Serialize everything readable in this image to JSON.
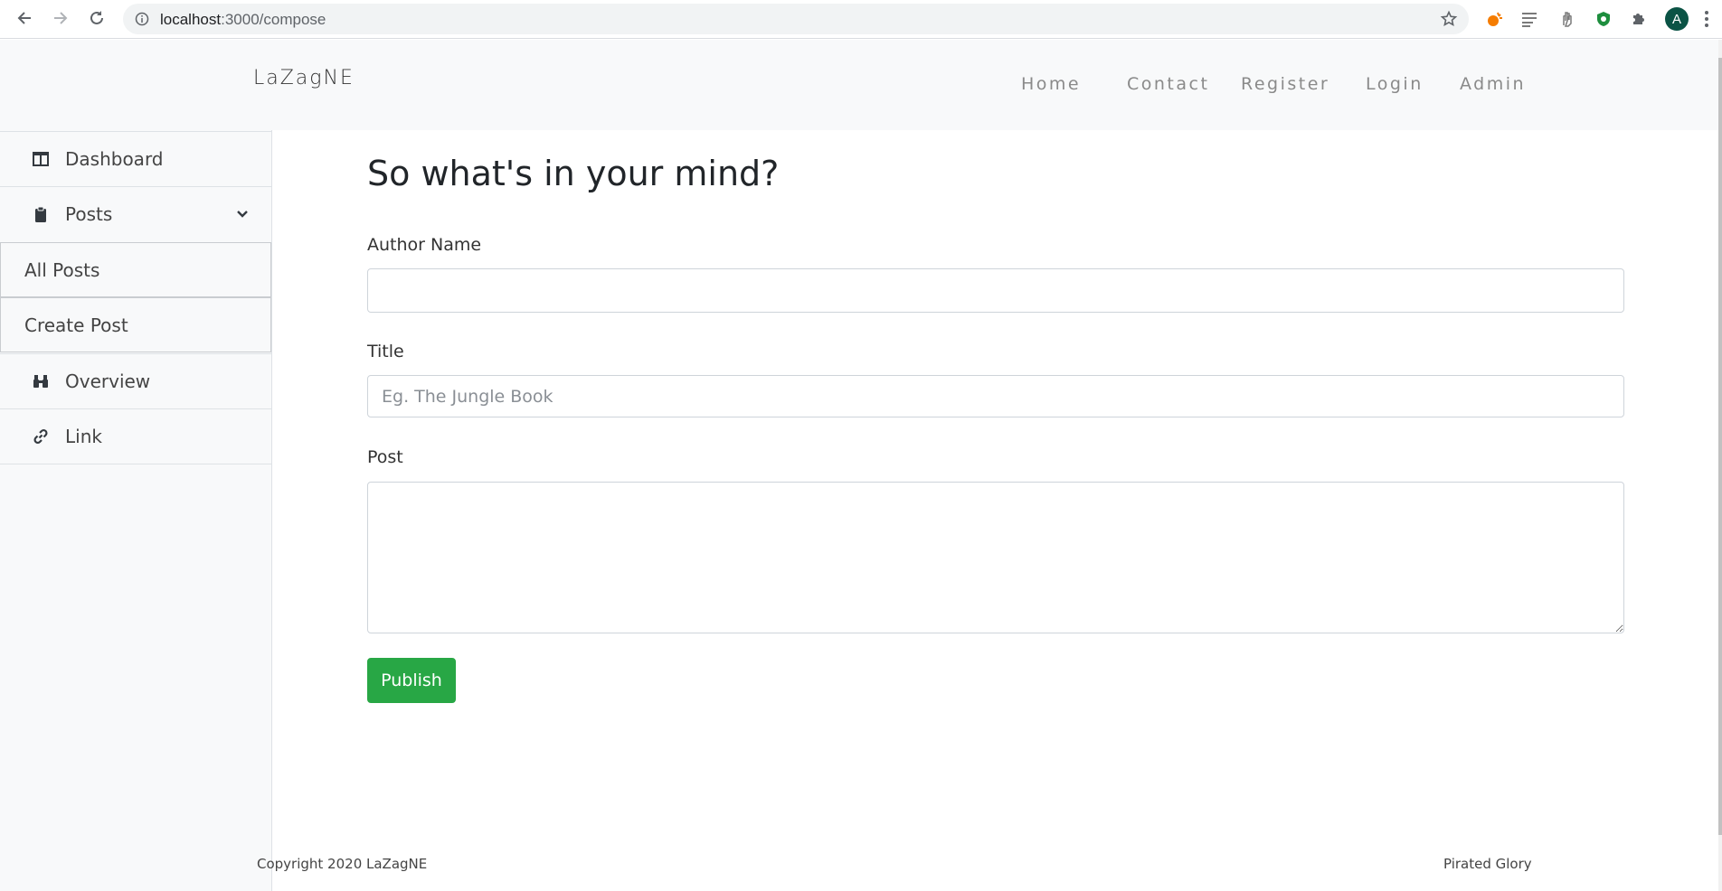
{
  "browser": {
    "url_host": "localhost",
    "url_path": ":3000/compose",
    "profile_initial": "A",
    "icons": [
      "back-arrow-icon",
      "forward-arrow-icon",
      "reload-icon",
      "info-icon",
      "star-icon",
      "puzzle-icon",
      "kebab-menu-icon"
    ],
    "accent": "#0b5345"
  },
  "site": {
    "brand": "LaZagNE",
    "nav": [
      {
        "label": "Home"
      },
      {
        "label": "Contact"
      },
      {
        "label": "Register"
      },
      {
        "label": "Login"
      },
      {
        "label": "Admin"
      }
    ]
  },
  "sidebar": {
    "items": [
      {
        "label": "Dashboard",
        "icon": "columns-icon"
      },
      {
        "label": "Posts",
        "icon": "clipboard-icon",
        "expanded": true
      },
      {
        "label": "Overview",
        "icon": "binoculars-icon"
      },
      {
        "label": "Link",
        "icon": "link-icon"
      }
    ],
    "sub_items": [
      {
        "label": "All Posts"
      },
      {
        "label": "Create Post"
      }
    ]
  },
  "form": {
    "title": "So what's in your mind?",
    "author_label": "Author Name",
    "author_value": "",
    "title_label": "Title",
    "title_placeholder": "Eg. The Jungle Book",
    "post_label": "Post",
    "post_value": "",
    "publish_label": "Publish",
    "publish_color": "#28a745"
  },
  "footer": {
    "copyright": "Copyright 2020 LaZagNE",
    "right_text": "Pirated Glory"
  }
}
